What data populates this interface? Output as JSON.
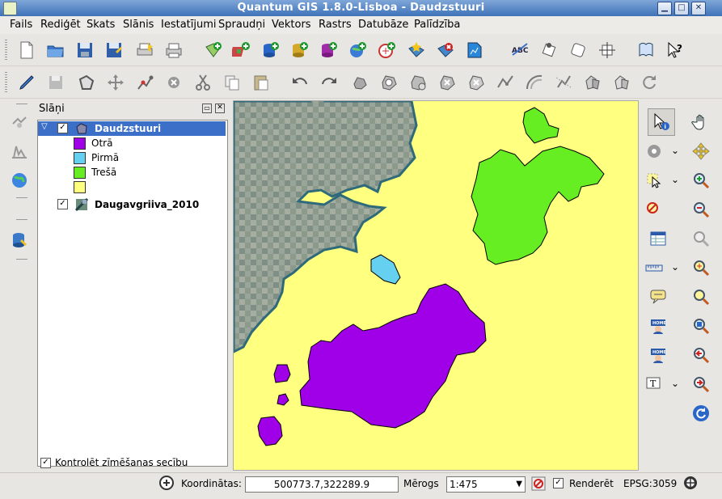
{
  "window": {
    "title": "Quantum GIS 1.8.0-Lisboa - Daudzstuuri"
  },
  "menu": [
    "Fails",
    "Rediģēt",
    "Skats",
    "Slānis",
    "Iestatījumi",
    "Spraudņi",
    "Vektors",
    "Rastrs",
    "Datubāze",
    "Palīdzība"
  ],
  "layers_panel": {
    "title": "Slāņi",
    "layers": [
      {
        "name": "Daudzstuuri",
        "checked": true,
        "expanded": true,
        "legend": [
          {
            "label": "Otrā",
            "color": "#a000e8"
          },
          {
            "label": "Pirmā",
            "color": "#66d0f0"
          },
          {
            "label": "Trešā",
            "color": "#66ee22"
          },
          {
            "label": "",
            "color": "#ffff80"
          }
        ]
      },
      {
        "name": "Daugavgriiva_2010",
        "checked": true,
        "expanded": false
      }
    ],
    "render_order_label": "Kontrolēt zīmēšanas secību",
    "render_order_checked": true
  },
  "status": {
    "coord_label": "Koordinātas:",
    "coord_value": "500773.7,322289.9",
    "scale_label": "Mērogs",
    "scale_value": "1:475",
    "render_label": "Renderēt",
    "render_checked": true,
    "crs": "EPSG:3059"
  },
  "colors": {
    "map_background": "#ffff80",
    "selection": "#3b6fc8"
  }
}
